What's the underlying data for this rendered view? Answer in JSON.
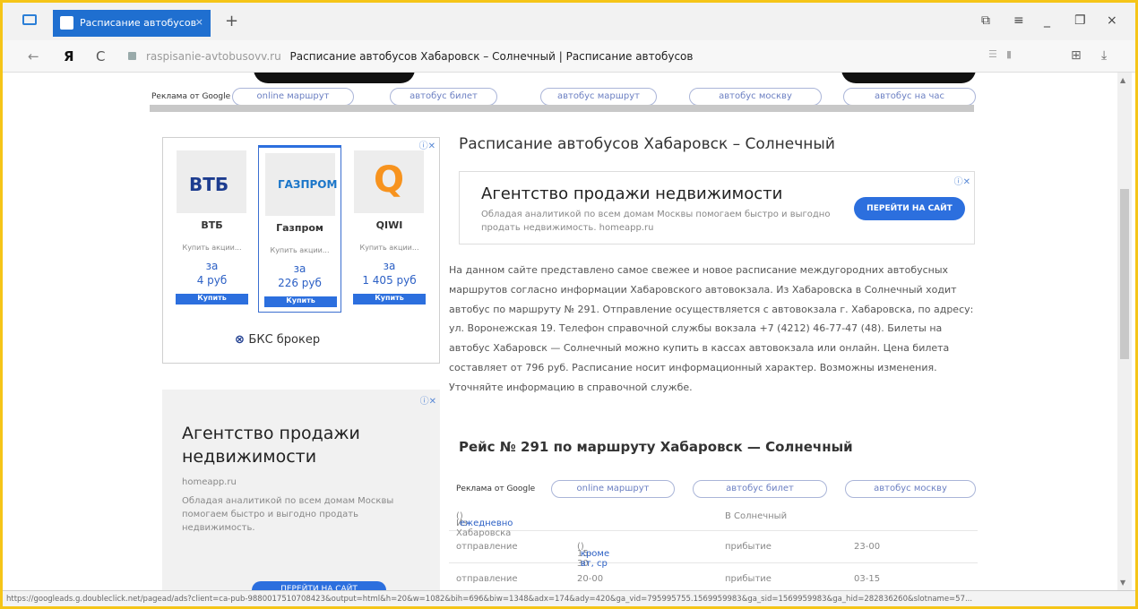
{
  "browser": {
    "tab_title": "Расписание автобусов",
    "tab_close": "×",
    "new_tab": "+",
    "host": "raspisanie-avtobusovv.ru",
    "page_title": "Расписание автобусов Хабаровск – Солнечный | Расписание автобусов",
    "logo": "Я",
    "back": "←",
    "reload": "C"
  },
  "ad_strip_1": {
    "label": "Реклама от Google",
    "pills": [
      "online маршрут",
      "автобус билет",
      "автобус маршрут",
      "автобус москву",
      "автобус на час"
    ]
  },
  "bank_ad": {
    "cards": [
      {
        "name": "ВТБ",
        "logo_text": "ВТБ",
        "buy": "Купить акции...",
        "za": "за",
        "price": "4 руб",
        "button": "Купить"
      },
      {
        "name": "Газпром",
        "logo_text": "ГАЗПРОМ",
        "buy": "Купить акции...",
        "za": "за",
        "price": "226 руб",
        "button": "Купить"
      },
      {
        "name": "QIWI",
        "logo_text": "Q",
        "buy": "Купить акции...",
        "za": "за",
        "price": "1 405 руб",
        "button": "Купить"
      }
    ],
    "broker": "БКС брокер",
    "adchoice": "ⓘ✕"
  },
  "realty_ad_side": {
    "heading": "Агентство продажи недвижимости",
    "domain": "homeapp.ru",
    "text": "Обладая аналитикой по всем домам Москвы помогаем быстро и выгодно продать недвижимость.",
    "cta": "ПЕРЕЙТИ НА САЙТ",
    "adchoice": "ⓘ✕"
  },
  "page": {
    "title": "Расписание автобусов Хабаровск – Солнечный",
    "description": "На данном сайте представлено самое свежее и новое расписание междугородних автобусных маршрутов согласно информации Хабаровского автовокзала. Из Хабаровска в Солнечный ходит автобус по маршруту № 291. Отправление осуществляется с автовокзала г. Хабаровска, по адресу: ул. Воронежская 19. Телефон справочной службы вокзала +7 (4212) 46-77-47 (48). Билеты на автобус Хабаровск — Солнечный можно купить в кассах автовокзала или онлайн. Цена билета составляет от 796 руб. Расписание носит информационный характер. Возможны изменения. Уточняйте информацию в справочной службе.",
    "route_heading": "Рейс № 291 по маршруту Хабаровск — Солнечный"
  },
  "realty_ad_top": {
    "heading": "Агентство продажи недвижимости",
    "text": "Обладая аналитикой по всем домам Москвы помогаем быстро и выгодно продать недвижимость. homeapp.ru",
    "cta": "ПЕРЕЙТИ НА САЙТ",
    "adchoice": "ⓘ✕"
  },
  "ad_strip_2": {
    "label": "Реклама от Google",
    "pills": [
      "online маршрут",
      "автобус билет",
      "автобус москву"
    ]
  },
  "schedule": {
    "from": "Из Хабаровска",
    "from_freq": "ежедневно",
    "to": "В Солнечный",
    "rows": [
      {
        "dep_label": "отправление",
        "dep_time": "15-30",
        "dep_note": "кроме вт, ср",
        "arr_label": "прибытие",
        "arr_time": "23-00"
      },
      {
        "dep_label": "отправление",
        "dep_time": "20-00",
        "dep_note": "",
        "arr_label": "прибытие",
        "arr_time": "03-15"
      }
    ]
  },
  "status_url": "https://googleads.g.doubleclick.net/pagead/ads?client=ca-pub-9880017510708423&output=html&h=20&w=1082&bih=696&biw=1348&adx=174&ady=420&ga_vid=795995755.1569959983&ga_sid=1569959983&ga_hid=282836260&slotname=57..."
}
